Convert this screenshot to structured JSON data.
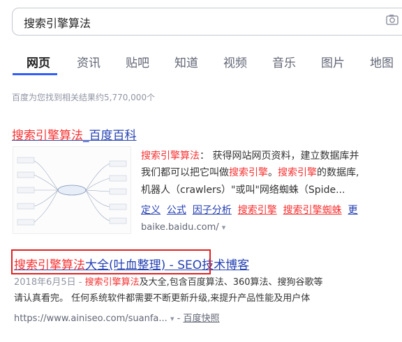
{
  "search": {
    "query": "搜索引擎算法"
  },
  "tabs": [
    "网页",
    "资讯",
    "贴吧",
    "知道",
    "视频",
    "音乐",
    "图片",
    "地图"
  ],
  "result_count": "百度为您找到相关结果约5,770,000个",
  "result1": {
    "title_hl": "搜索引擎算法",
    "title_rest": "_百度百科",
    "line1_hl": "搜索引擎算法",
    "line1_rest": "：  获得网站网页资料，建立数据库并",
    "line2_a": "我们都可以把它叫做",
    "line2_hl1": "搜索引擎",
    "line2_b": "。",
    "line2_hl2": "搜索引擎",
    "line2_c": "的数据库,",
    "line3": "机器人（crawlers）\"或叫\"网络蜘蛛（Spide...",
    "links": [
      "定义",
      "公式",
      "因子分析",
      "搜索引擎",
      "搜索引擎蜘蛛",
      "更"
    ],
    "url": "baike.baidu.com/",
    "url_arrow": "▾"
  },
  "result2": {
    "title_hl": "搜索引擎算法",
    "title_rest": "大全(吐血整理) - SEO技术博客",
    "line1_date": "2018年6月5日 - ",
    "line1_hl": "搜索引擎算法",
    "line1_rest": "及大全,包含百度算法、360算法、搜狗谷歌等",
    "line2": "请认真看完。 任何系统软件都需要不断更新升级,来提升产品性能及用户体",
    "url": "https://www.ainiseo.com/suanfa...",
    "url_arrow": "▾",
    "cache_sep": "-",
    "cache": "百度快照"
  }
}
